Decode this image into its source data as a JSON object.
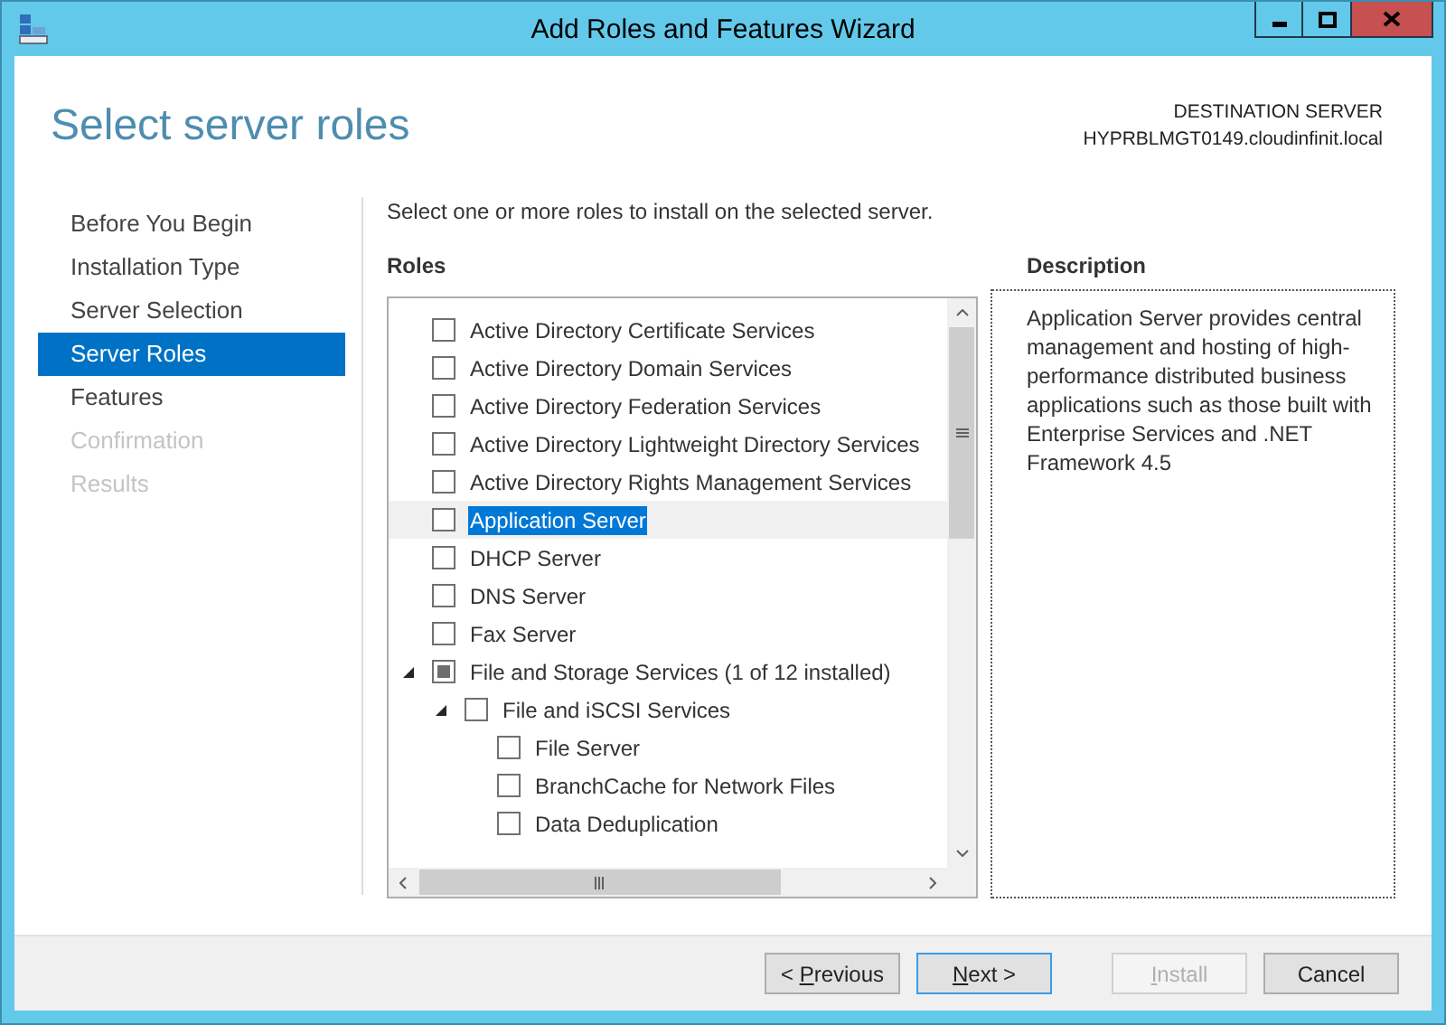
{
  "window": {
    "title": "Add Roles and Features Wizard"
  },
  "page_title": "Select server roles",
  "destination": {
    "label": "DESTINATION SERVER",
    "server": "HYPRBLMGT0149.cloudinfinit.local"
  },
  "steps": [
    {
      "label": "Before You Begin",
      "selected": false,
      "disabled": false
    },
    {
      "label": "Installation Type",
      "selected": false,
      "disabled": false
    },
    {
      "label": "Server Selection",
      "selected": false,
      "disabled": false
    },
    {
      "label": "Server Roles",
      "selected": true,
      "disabled": false
    },
    {
      "label": "Features",
      "selected": false,
      "disabled": false
    },
    {
      "label": "Confirmation",
      "selected": false,
      "disabled": true
    },
    {
      "label": "Results",
      "selected": false,
      "disabled": true
    }
  ],
  "instruction": "Select one or more roles to install on the selected server.",
  "roles": {
    "heading": "Roles",
    "items": [
      {
        "label": "Active Directory Certificate Services",
        "checked": false,
        "partial": false,
        "selected": false
      },
      {
        "label": "Active Directory Domain Services",
        "checked": false,
        "partial": false,
        "selected": false
      },
      {
        "label": "Active Directory Federation Services",
        "checked": false,
        "partial": false,
        "selected": false
      },
      {
        "label": "Active Directory Lightweight Directory Services",
        "checked": false,
        "partial": false,
        "selected": false
      },
      {
        "label": "Active Directory Rights Management Services",
        "checked": false,
        "partial": false,
        "selected": false
      },
      {
        "label": "Application Server",
        "checked": false,
        "partial": false,
        "selected": true
      },
      {
        "label": "DHCP Server",
        "checked": false,
        "partial": false,
        "selected": false
      },
      {
        "label": "DNS Server",
        "checked": false,
        "partial": false,
        "selected": false
      },
      {
        "label": "Fax Server",
        "checked": false,
        "partial": false,
        "selected": false
      },
      {
        "label": "File and Storage Services (1 of 12 installed)",
        "checked": false,
        "partial": true,
        "selected": false,
        "expanded": true,
        "children": [
          {
            "label": "File and iSCSI Services",
            "checked": false,
            "partial": false,
            "selected": false,
            "expanded": true,
            "children": [
              {
                "label": "File Server",
                "checked": false,
                "partial": false,
                "selected": false
              },
              {
                "label": "BranchCache for Network Files",
                "checked": false,
                "partial": false,
                "selected": false
              },
              {
                "label": "Data Deduplication",
                "checked": false,
                "partial": false,
                "selected": false
              }
            ]
          }
        ]
      }
    ]
  },
  "description": {
    "heading": "Description",
    "text": "Application Server provides central management and hosting of high-performance distributed business applications such as those built with Enterprise Services and .NET Framework 4.5"
  },
  "buttons": [
    {
      "before": "< ",
      "key": "P",
      "after": "revious",
      "disabled": false,
      "focused": false
    },
    {
      "key": "N",
      "after": "ext >",
      "disabled": false,
      "focused": true
    },
    {
      "key": "I",
      "after": "nstall",
      "disabled": true,
      "focused": false
    },
    {
      "before": "Cancel",
      "disabled": false,
      "focused": false
    }
  ]
}
